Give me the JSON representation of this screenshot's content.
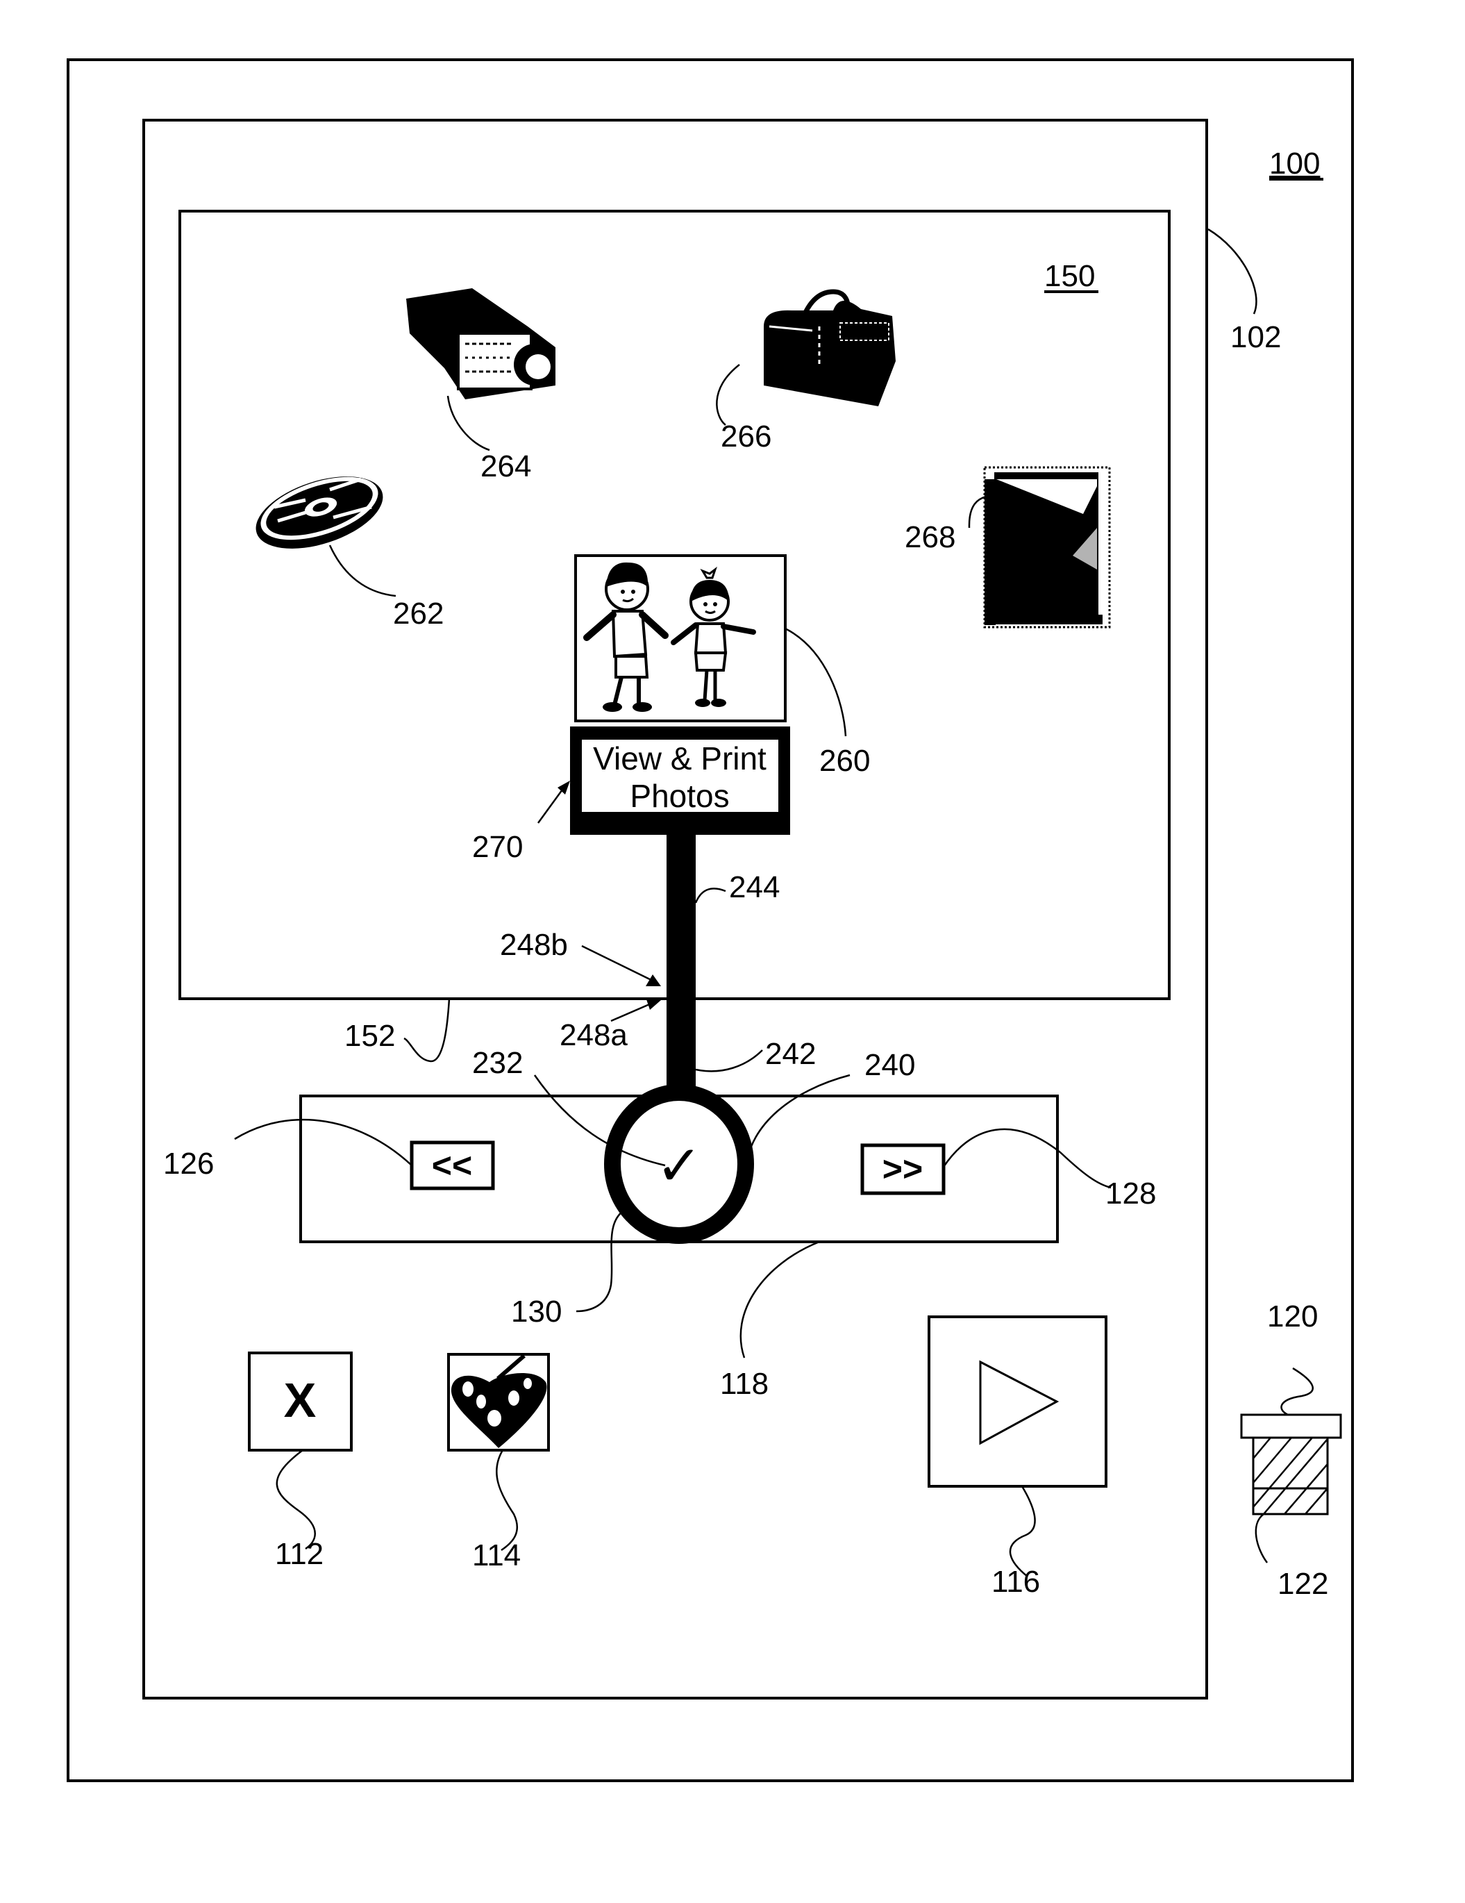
{
  "figure": {
    "device_ref": "100",
    "housing_ref": "102",
    "screen_ref": "150",
    "screen_edge_ref": "152",
    "nav_bar_ref": "118",
    "wheel_ref": "130"
  },
  "screen_icons": [
    {
      "ref": "264",
      "name": "projector"
    },
    {
      "ref": "266",
      "name": "toolbox"
    },
    {
      "ref": "262",
      "name": "disc"
    },
    {
      "ref": "268",
      "name": "photo"
    },
    {
      "ref": "260",
      "name": "kids-picture"
    }
  ],
  "selected_item": {
    "label_line1": "View & Print",
    "label_line2": "Photos",
    "label_ref": "270",
    "stem_ref": "244",
    "stem_lower_ref": "242",
    "boundary_upper_ref": "248b",
    "boundary_lower_ref": "248a"
  },
  "wheel": {
    "ring_ref": "240",
    "check_ref": "232",
    "check_glyph": "✓"
  },
  "nav": {
    "prev_label": "<<",
    "prev_ref": "126",
    "next_label": ">>",
    "next_ref": "128"
  },
  "buttons": {
    "close_label": "X",
    "close_ref": "112",
    "art_ref": "114",
    "play_ref": "116"
  },
  "port": {
    "cap_ref": "120",
    "body_ref": "122"
  }
}
